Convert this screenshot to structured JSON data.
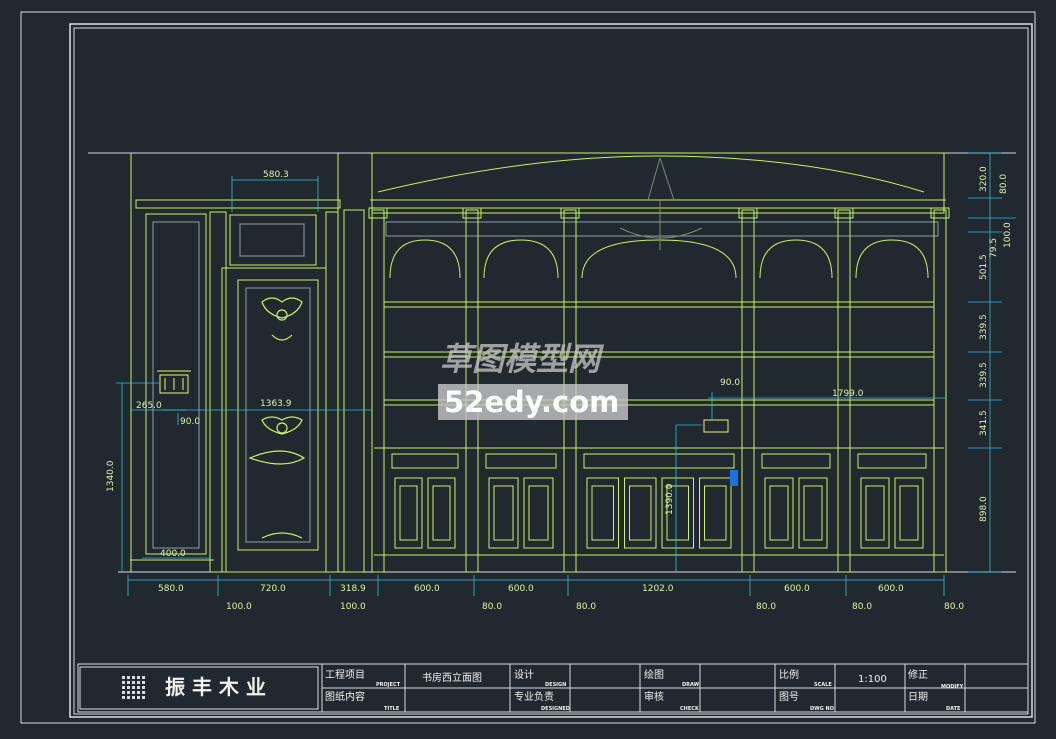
{
  "colors": {
    "background": "#212830",
    "frame": "#d8dde3",
    "cabinet": "#c9f45a",
    "dimension": "#27c4cf",
    "text": "#d9f6a8",
    "watermark_bg": "#c8c8c8",
    "marker": "#1e6fe0"
  },
  "watermark": {
    "line1": "草图模型网",
    "line2": "52edy.com"
  },
  "dims": {
    "top": "580.3",
    "d265": "265.0",
    "d90a": "90.0",
    "d1363": "1363.9",
    "d1340": "1340.0",
    "d400": "400.0",
    "d90b": "90.0",
    "d1799": "1799.0",
    "d1390": "1390.0",
    "bottom": [
      "580.0",
      "720.0",
      "318.9",
      "600.0",
      "600.0",
      "1202.0",
      "600.0",
      "600.0"
    ],
    "bottom2": [
      "100.0",
      "100.0",
      "80.0",
      "80.0",
      "80.0",
      "80.0",
      "80.0"
    ],
    "right": [
      "320.0",
      "80.0",
      "100.0",
      "79.5",
      "501.5",
      "339.5",
      "339.5",
      "341.5",
      "898.0"
    ]
  },
  "title_block": {
    "company": "振 丰 木 业",
    "project_label": "工程项目",
    "project_en": "PROJECT",
    "title_label": "图纸内容",
    "title_en": "TITLE",
    "drawing_name": "书房西立面图",
    "design_label": "设计",
    "design_en": "DESIGN",
    "designed_by_label": "专业负责",
    "designed_by_en": "DESIGNED",
    "draw_label": "绘图",
    "draw_en": "DRAW",
    "check_label": "审核",
    "check_en": "CHECK",
    "scale_label": "比例",
    "scale_en": "SCALE",
    "scale_value": "1:100",
    "dwg_label": "图号",
    "dwg_en": "DWG NO",
    "modify_label": "修正",
    "modify_en": "MODIFY",
    "date_label": "日期",
    "date_en": "DATE"
  }
}
